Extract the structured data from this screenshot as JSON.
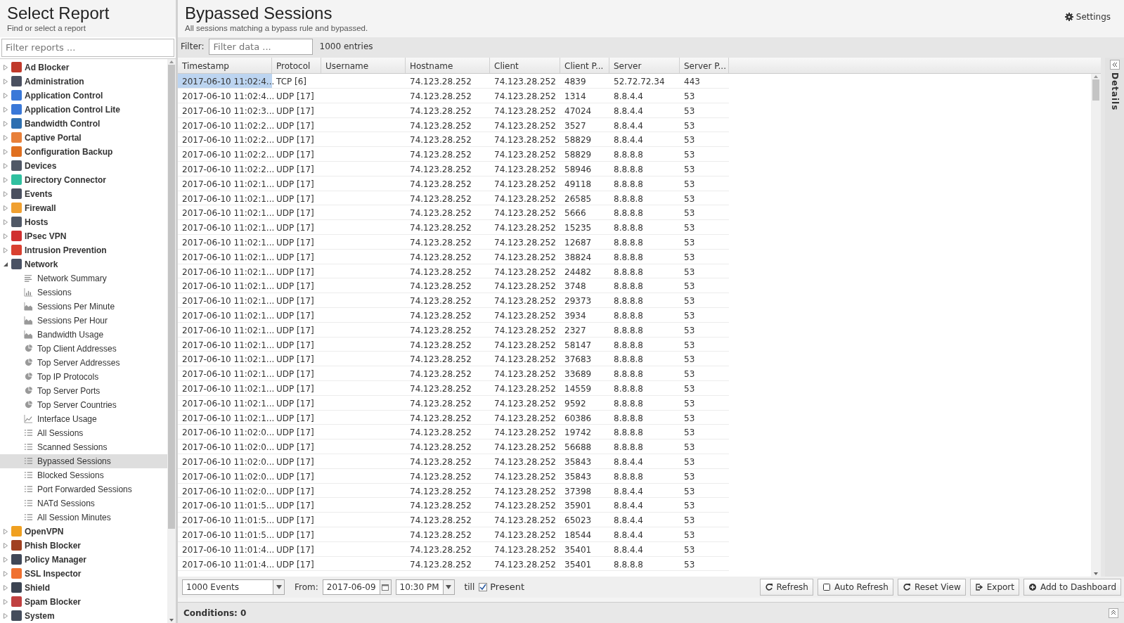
{
  "sidebar": {
    "title": "Select Report",
    "subtitle": "Find or select a report",
    "filter": {
      "placeholder": "Filter reports ..."
    },
    "items": [
      {
        "label": "Ad Blocker",
        "color": "#c0392b",
        "expanded": false,
        "selected": false
      },
      {
        "label": "Administration",
        "color": "#4a5060",
        "expanded": false,
        "selected": false
      },
      {
        "label": "Application Control",
        "color": "#3a78d8",
        "expanded": false,
        "selected": false
      },
      {
        "label": "Application Control Lite",
        "color": "#3a78d8",
        "expanded": false,
        "selected": false
      },
      {
        "label": "Bandwidth Control",
        "color": "#2d6fb0",
        "expanded": false,
        "selected": false
      },
      {
        "label": "Captive Portal",
        "color": "#e8803a",
        "expanded": false,
        "selected": false
      },
      {
        "label": "Configuration Backup",
        "color": "#e07020",
        "expanded": false,
        "selected": false
      },
      {
        "label": "Devices",
        "color": "#505866",
        "expanded": false,
        "selected": false
      },
      {
        "label": "Directory Connector",
        "color": "#30c0a0",
        "expanded": false,
        "selected": false
      },
      {
        "label": "Events",
        "color": "#4a5060",
        "expanded": false,
        "selected": false
      },
      {
        "label": "Firewall",
        "color": "#f0a030",
        "expanded": false,
        "selected": false
      },
      {
        "label": "Hosts",
        "color": "#505866",
        "expanded": false,
        "selected": false
      },
      {
        "label": "IPsec VPN",
        "color": "#d03030",
        "expanded": false,
        "selected": false
      },
      {
        "label": "Intrusion Prevention",
        "color": "#d94030",
        "expanded": false,
        "selected": false
      },
      {
        "label": "Network",
        "color": "#4a5264",
        "expanded": true,
        "selected": false,
        "children": [
          {
            "label": "Network Summary",
            "kind": "text",
            "selected": false
          },
          {
            "label": "Sessions",
            "kind": "bar",
            "selected": false
          },
          {
            "label": "Sessions Per Minute",
            "kind": "area",
            "selected": false
          },
          {
            "label": "Sessions Per Hour",
            "kind": "area",
            "selected": false
          },
          {
            "label": "Bandwidth Usage",
            "kind": "area",
            "selected": false
          },
          {
            "label": "Top Client Addresses",
            "kind": "pie",
            "selected": false
          },
          {
            "label": "Top Server Addresses",
            "kind": "pie",
            "selected": false
          },
          {
            "label": "Top IP Protocols",
            "kind": "pie",
            "selected": false
          },
          {
            "label": "Top Server Ports",
            "kind": "pie",
            "selected": false
          },
          {
            "label": "Top Server Countries",
            "kind": "pie",
            "selected": false
          },
          {
            "label": "Interface Usage",
            "kind": "line",
            "selected": false
          },
          {
            "label": "All Sessions",
            "kind": "list",
            "selected": false
          },
          {
            "label": "Scanned Sessions",
            "kind": "list",
            "selected": false
          },
          {
            "label": "Bypassed Sessions",
            "kind": "list",
            "selected": true
          },
          {
            "label": "Blocked Sessions",
            "kind": "list",
            "selected": false
          },
          {
            "label": "Port Forwarded Sessions",
            "kind": "list",
            "selected": false
          },
          {
            "label": "NATd Sessions",
            "kind": "list",
            "selected": false
          },
          {
            "label": "All Session Minutes",
            "kind": "list",
            "selected": false
          }
        ]
      },
      {
        "label": "OpenVPN",
        "color": "#f0a020",
        "expanded": false,
        "selected": false
      },
      {
        "label": "Phish Blocker",
        "color": "#a04020",
        "expanded": false,
        "selected": false
      },
      {
        "label": "Policy Manager",
        "color": "#404858",
        "expanded": false,
        "selected": false
      },
      {
        "label": "SSL Inspector",
        "color": "#f07030",
        "expanded": false,
        "selected": false
      },
      {
        "label": "Shield",
        "color": "#3c4452",
        "expanded": false,
        "selected": false
      },
      {
        "label": "Spam Blocker",
        "color": "#c04040",
        "expanded": false,
        "selected": false
      },
      {
        "label": "System",
        "color": "#454d5c",
        "expanded": false,
        "selected": false
      }
    ]
  },
  "header": {
    "title": "Bypassed Sessions",
    "subtitle": "All sessions matching a bypass rule and bypassed.",
    "settings": "Settings"
  },
  "filter_bar": {
    "label": "Filter:",
    "placeholder": "Filter data ...",
    "count": "1000 entries"
  },
  "table": {
    "columns": [
      "Timestamp",
      "Protocol",
      "Username",
      "Hostname",
      "Client",
      "Client P...",
      "Server",
      "Server P..."
    ],
    "rows": [
      {
        "selected": true,
        "cells": [
          "2017-06-10 11:02:4...",
          "TCP [6]",
          "",
          "74.123.28.252",
          "74.123.28.252",
          "4839",
          "52.72.72.34",
          "443"
        ]
      },
      {
        "selected": false,
        "cells": [
          "2017-06-10 11:02:4...",
          "UDP [17]",
          "",
          "74.123.28.252",
          "74.123.28.252",
          "1314",
          "8.8.4.4",
          "53"
        ]
      },
      {
        "selected": false,
        "cells": [
          "2017-06-10 11:02:3...",
          "UDP [17]",
          "",
          "74.123.28.252",
          "74.123.28.252",
          "47024",
          "8.8.4.4",
          "53"
        ]
      },
      {
        "selected": false,
        "cells": [
          "2017-06-10 11:02:2...",
          "UDP [17]",
          "",
          "74.123.28.252",
          "74.123.28.252",
          "3527",
          "8.8.4.4",
          "53"
        ]
      },
      {
        "selected": false,
        "cells": [
          "2017-06-10 11:02:2...",
          "UDP [17]",
          "",
          "74.123.28.252",
          "74.123.28.252",
          "58829",
          "8.8.4.4",
          "53"
        ]
      },
      {
        "selected": false,
        "cells": [
          "2017-06-10 11:02:2...",
          "UDP [17]",
          "",
          "74.123.28.252",
          "74.123.28.252",
          "58829",
          "8.8.8.8",
          "53"
        ]
      },
      {
        "selected": false,
        "cells": [
          "2017-06-10 11:02:2...",
          "UDP [17]",
          "",
          "74.123.28.252",
          "74.123.28.252",
          "58946",
          "8.8.8.8",
          "53"
        ]
      },
      {
        "selected": false,
        "cells": [
          "2017-06-10 11:02:1...",
          "UDP [17]",
          "",
          "74.123.28.252",
          "74.123.28.252",
          "49118",
          "8.8.8.8",
          "53"
        ]
      },
      {
        "selected": false,
        "cells": [
          "2017-06-10 11:02:1...",
          "UDP [17]",
          "",
          "74.123.28.252",
          "74.123.28.252",
          "26585",
          "8.8.8.8",
          "53"
        ]
      },
      {
        "selected": false,
        "cells": [
          "2017-06-10 11:02:1...",
          "UDP [17]",
          "",
          "74.123.28.252",
          "74.123.28.252",
          "5666",
          "8.8.8.8",
          "53"
        ]
      },
      {
        "selected": false,
        "cells": [
          "2017-06-10 11:02:1...",
          "UDP [17]",
          "",
          "74.123.28.252",
          "74.123.28.252",
          "15235",
          "8.8.8.8",
          "53"
        ]
      },
      {
        "selected": false,
        "cells": [
          "2017-06-10 11:02:1...",
          "UDP [17]",
          "",
          "74.123.28.252",
          "74.123.28.252",
          "12687",
          "8.8.8.8",
          "53"
        ]
      },
      {
        "selected": false,
        "cells": [
          "2017-06-10 11:02:1...",
          "UDP [17]",
          "",
          "74.123.28.252",
          "74.123.28.252",
          "38824",
          "8.8.8.8",
          "53"
        ]
      },
      {
        "selected": false,
        "cells": [
          "2017-06-10 11:02:1...",
          "UDP [17]",
          "",
          "74.123.28.252",
          "74.123.28.252",
          "24482",
          "8.8.8.8",
          "53"
        ]
      },
      {
        "selected": false,
        "cells": [
          "2017-06-10 11:02:1...",
          "UDP [17]",
          "",
          "74.123.28.252",
          "74.123.28.252",
          "3748",
          "8.8.8.8",
          "53"
        ]
      },
      {
        "selected": false,
        "cells": [
          "2017-06-10 11:02:1...",
          "UDP [17]",
          "",
          "74.123.28.252",
          "74.123.28.252",
          "29373",
          "8.8.8.8",
          "53"
        ]
      },
      {
        "selected": false,
        "cells": [
          "2017-06-10 11:02:1...",
          "UDP [17]",
          "",
          "74.123.28.252",
          "74.123.28.252",
          "3934",
          "8.8.8.8",
          "53"
        ]
      },
      {
        "selected": false,
        "cells": [
          "2017-06-10 11:02:1...",
          "UDP [17]",
          "",
          "74.123.28.252",
          "74.123.28.252",
          "2327",
          "8.8.8.8",
          "53"
        ]
      },
      {
        "selected": false,
        "cells": [
          "2017-06-10 11:02:1...",
          "UDP [17]",
          "",
          "74.123.28.252",
          "74.123.28.252",
          "58147",
          "8.8.8.8",
          "53"
        ]
      },
      {
        "selected": false,
        "cells": [
          "2017-06-10 11:02:1...",
          "UDP [17]",
          "",
          "74.123.28.252",
          "74.123.28.252",
          "37683",
          "8.8.8.8",
          "53"
        ]
      },
      {
        "selected": false,
        "cells": [
          "2017-06-10 11:02:1...",
          "UDP [17]",
          "",
          "74.123.28.252",
          "74.123.28.252",
          "33689",
          "8.8.8.8",
          "53"
        ]
      },
      {
        "selected": false,
        "cells": [
          "2017-06-10 11:02:1...",
          "UDP [17]",
          "",
          "74.123.28.252",
          "74.123.28.252",
          "14559",
          "8.8.8.8",
          "53"
        ]
      },
      {
        "selected": false,
        "cells": [
          "2017-06-10 11:02:1...",
          "UDP [17]",
          "",
          "74.123.28.252",
          "74.123.28.252",
          "9592",
          "8.8.8.8",
          "53"
        ]
      },
      {
        "selected": false,
        "cells": [
          "2017-06-10 11:02:1...",
          "UDP [17]",
          "",
          "74.123.28.252",
          "74.123.28.252",
          "60386",
          "8.8.8.8",
          "53"
        ]
      },
      {
        "selected": false,
        "cells": [
          "2017-06-10 11:02:0...",
          "UDP [17]",
          "",
          "74.123.28.252",
          "74.123.28.252",
          "19742",
          "8.8.8.8",
          "53"
        ]
      },
      {
        "selected": false,
        "cells": [
          "2017-06-10 11:02:0...",
          "UDP [17]",
          "",
          "74.123.28.252",
          "74.123.28.252",
          "56688",
          "8.8.8.8",
          "53"
        ]
      },
      {
        "selected": false,
        "cells": [
          "2017-06-10 11:02:0...",
          "UDP [17]",
          "",
          "74.123.28.252",
          "74.123.28.252",
          "35843",
          "8.8.4.4",
          "53"
        ]
      },
      {
        "selected": false,
        "cells": [
          "2017-06-10 11:02:0...",
          "UDP [17]",
          "",
          "74.123.28.252",
          "74.123.28.252",
          "35843",
          "8.8.8.8",
          "53"
        ]
      },
      {
        "selected": false,
        "cells": [
          "2017-06-10 11:02:0...",
          "UDP [17]",
          "",
          "74.123.28.252",
          "74.123.28.252",
          "37398",
          "8.8.4.4",
          "53"
        ]
      },
      {
        "selected": false,
        "cells": [
          "2017-06-10 11:01:5...",
          "UDP [17]",
          "",
          "74.123.28.252",
          "74.123.28.252",
          "35901",
          "8.8.4.4",
          "53"
        ]
      },
      {
        "selected": false,
        "cells": [
          "2017-06-10 11:01:5...",
          "UDP [17]",
          "",
          "74.123.28.252",
          "74.123.28.252",
          "65023",
          "8.8.4.4",
          "53"
        ]
      },
      {
        "selected": false,
        "cells": [
          "2017-06-10 11:01:5...",
          "UDP [17]",
          "",
          "74.123.28.252",
          "74.123.28.252",
          "18544",
          "8.8.4.4",
          "53"
        ]
      },
      {
        "selected": false,
        "cells": [
          "2017-06-10 11:01:4...",
          "UDP [17]",
          "",
          "74.123.28.252",
          "74.123.28.252",
          "35401",
          "8.8.4.4",
          "53"
        ]
      },
      {
        "selected": false,
        "cells": [
          "2017-06-10 11:01:4...",
          "UDP [17]",
          "",
          "74.123.28.252",
          "74.123.28.252",
          "35401",
          "8.8.8.8",
          "53"
        ]
      }
    ]
  },
  "details_panel": {
    "label": "Details"
  },
  "toolbar": {
    "limit": "1000 Events",
    "from_label": "From:",
    "date": "2017-06-09",
    "time": "10:30 PM",
    "till_label": "till",
    "present": {
      "label": "Present",
      "checked": true
    },
    "buttons": [
      {
        "label": "Refresh",
        "kind": "refresh"
      },
      {
        "label": "Auto Refresh",
        "kind": "toggle"
      },
      {
        "label": "Reset View",
        "kind": "reset"
      },
      {
        "label": "Export",
        "kind": "export"
      },
      {
        "label": "Add to Dashboard",
        "kind": "add"
      }
    ]
  },
  "conditions": "Conditions: 0"
}
